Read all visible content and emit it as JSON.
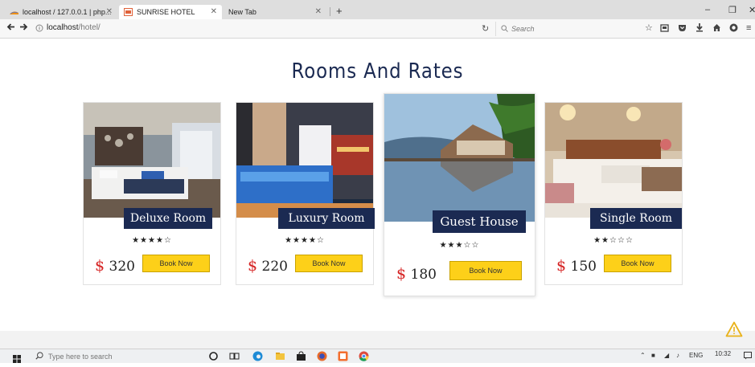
{
  "browser": {
    "tabs": [
      {
        "label": "localhost / 127.0.0.1 | php..."
      },
      {
        "label": "SUNRISE HOTEL"
      },
      {
        "label": "New Tab"
      }
    ],
    "address": {
      "host": "localhost",
      "path": "/hotel/"
    },
    "search_placeholder": "Search"
  },
  "page": {
    "title": "Rooms And Rates",
    "rooms": [
      {
        "name": "Deluxe Room",
        "stars": "★★★★☆",
        "currency": "$",
        "price": "320",
        "button": "Book Now"
      },
      {
        "name": "Luxury Room",
        "stars": "★★★★☆",
        "currency": "$",
        "price": "220",
        "button": "Book Now"
      },
      {
        "name": "Guest House",
        "stars": "★★★☆☆",
        "currency": "$",
        "price": "180",
        "button": "Book Now"
      },
      {
        "name": "Single Room",
        "stars": "★★☆☆☆",
        "currency": "$",
        "price": "150",
        "button": "Book Now"
      }
    ]
  },
  "taskbar": {
    "search_placeholder": "Type here to search",
    "language": "ENG",
    "time": "10:32"
  },
  "colors": {
    "navy": "#1b2a52",
    "button_yellow": "#fdd019",
    "price_red": "#d62424"
  },
  "icons": [
    "back-icon",
    "forward-icon",
    "info-icon",
    "reload-icon",
    "search-icon",
    "star-icon",
    "reading-list-icon",
    "pocket-icon",
    "download-icon",
    "home-icon",
    "account-icon",
    "menu-icon",
    "warning-icon",
    "windows-icon"
  ]
}
